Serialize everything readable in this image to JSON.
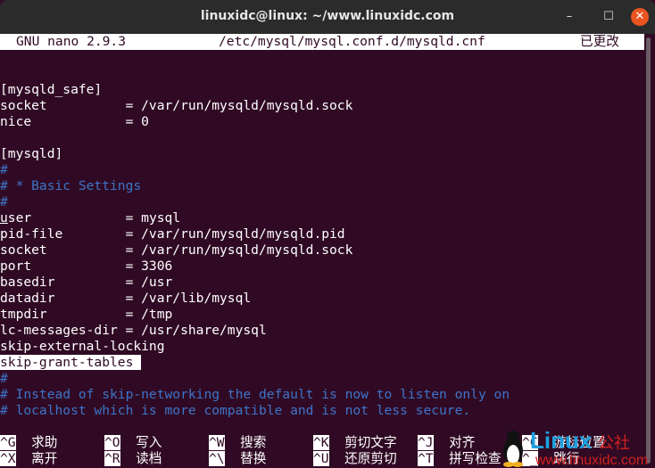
{
  "window": {
    "title": "linuxidc@linux: ~/www.linuxidc.com",
    "minimize": "–",
    "maximize": "☐",
    "close": "✕"
  },
  "nano": {
    "version": "GNU nano 2.9.3",
    "file": "/etc/mysql/mysql.conf.d/mysqld.cnf",
    "status": "已更改"
  },
  "lines": [
    {
      "t": "",
      "c": ""
    },
    {
      "t": "",
      "c": ""
    },
    {
      "t": "[mysqld_safe]",
      "c": ""
    },
    {
      "t": "socket          = /var/run/mysqld/mysqld.sock",
      "c": ""
    },
    {
      "t": "nice            = 0",
      "c": ""
    },
    {
      "t": "",
      "c": ""
    },
    {
      "t": "[mysqld]",
      "c": ""
    },
    {
      "t": "#",
      "c": "cmt"
    },
    {
      "t": "# * Basic Settings",
      "c": "cmt"
    },
    {
      "t": "#",
      "c": "cmt"
    },
    {
      "t": "user            = mysql",
      "c": "user"
    },
    {
      "t": "pid-file        = /var/run/mysqld/mysqld.pid",
      "c": ""
    },
    {
      "t": "socket          = /var/run/mysqld/mysqld.sock",
      "c": ""
    },
    {
      "t": "port            = 3306",
      "c": ""
    },
    {
      "t": "basedir         = /usr",
      "c": ""
    },
    {
      "t": "datadir         = /var/lib/mysql",
      "c": ""
    },
    {
      "t": "tmpdir          = /tmp",
      "c": ""
    },
    {
      "t": "lc-messages-dir = /usr/share/mysql",
      "c": ""
    },
    {
      "t": "skip-external-locking",
      "c": ""
    },
    {
      "t": "skip-grant-tables ",
      "c": "hl"
    },
    {
      "t": "#",
      "c": "cmt"
    },
    {
      "t": "# Instead of skip-networking the default is now to listen only on",
      "c": "cmt"
    },
    {
      "t": "# localhost which is more compatible and is not less secure.",
      "c": "cmt"
    }
  ],
  "shortcuts": [
    {
      "key": "^G",
      "label": "求助"
    },
    {
      "key": "^X",
      "label": "离开"
    },
    {
      "key": "^O",
      "label": "写入"
    },
    {
      "key": "^R",
      "label": "读档"
    },
    {
      "key": "^W",
      "label": "搜索"
    },
    {
      "key": "^\\",
      "label": "替换"
    },
    {
      "key": "^K",
      "label": "剪切文字"
    },
    {
      "key": "^U",
      "label": "还原剪切"
    },
    {
      "key": "^J",
      "label": "对齐"
    },
    {
      "key": "^T",
      "label": "拼写检查"
    },
    {
      "key": "^C",
      "label": "游标位置"
    },
    {
      "key": "^_",
      "label": "跳行"
    }
  ],
  "watermark": {
    "logo": "Linux公社",
    "url": "www.linuxidc.com"
  }
}
